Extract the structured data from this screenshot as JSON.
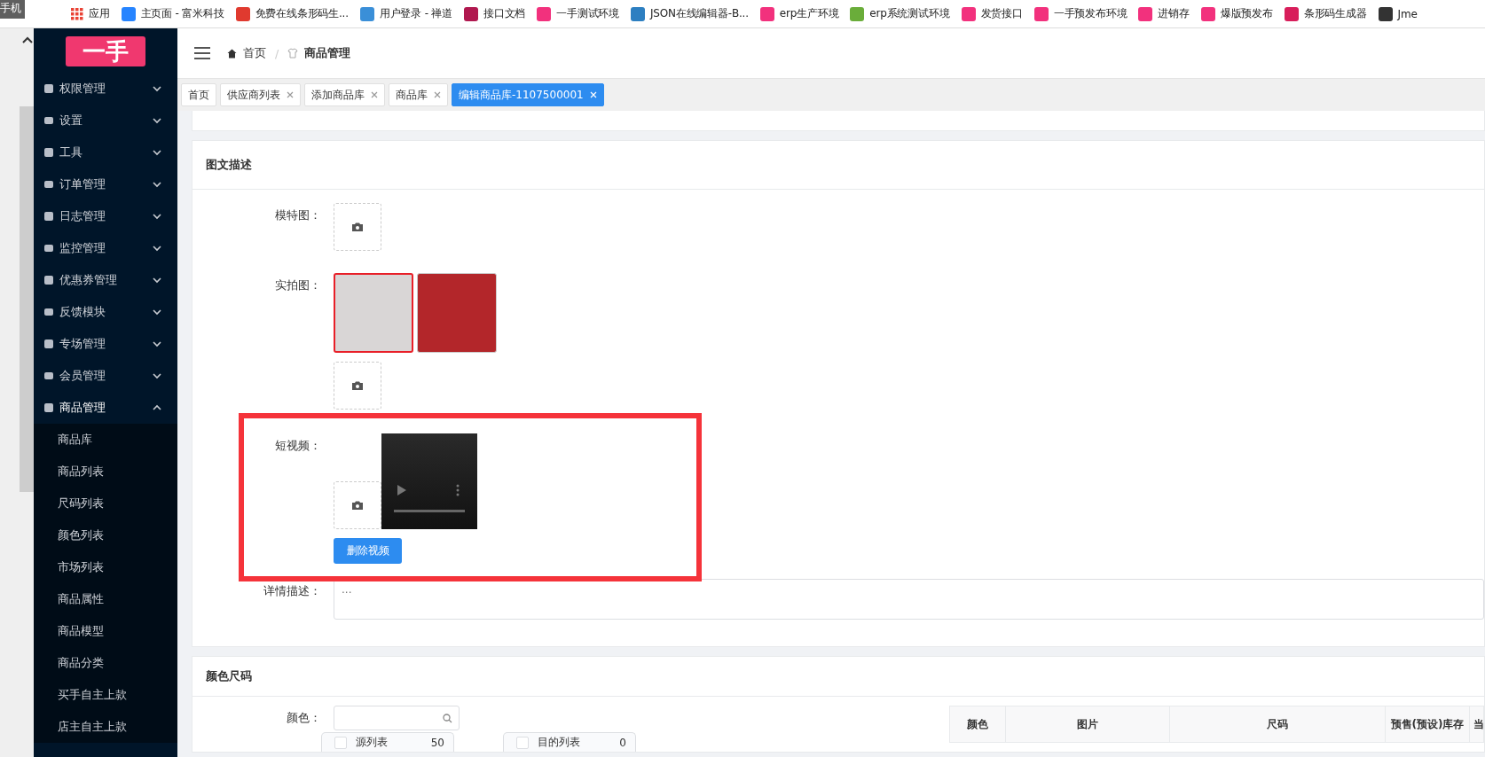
{
  "browser": {
    "tab_fragment": "手机",
    "bookmarks": [
      {
        "label": "应用",
        "color": "#e94235"
      },
      {
        "label": "主页面 - 富米科技",
        "color": "#2684ff"
      },
      {
        "label": "免费在线条形码生...",
        "color": "#e03a2f"
      },
      {
        "label": "用户登录 - 禅道",
        "color": "#3a8fd8"
      },
      {
        "label": "接口文档",
        "color": "#b0184f"
      },
      {
        "label": "一手测试环境",
        "color": "#f2317d"
      },
      {
        "label": "JSON在线编辑器-B...",
        "color": "#2d7fc1"
      },
      {
        "label": "erp生产环境",
        "color": "#f2317d"
      },
      {
        "label": "erp系统测试环境",
        "color": "#6aad3a"
      },
      {
        "label": "发货接口",
        "color": "#f2317d"
      },
      {
        "label": "一手预发布环境",
        "color": "#f2317d"
      },
      {
        "label": "进销存",
        "color": "#f2317d"
      },
      {
        "label": "爆版预发布",
        "color": "#f2317d"
      },
      {
        "label": "条形码生成器",
        "color": "#d81e5b"
      },
      {
        "label": "Jme",
        "color": "#333333"
      }
    ]
  },
  "sidebar": {
    "logo": "一手",
    "items": [
      {
        "label": "权限管理",
        "expanded": false
      },
      {
        "label": "设置",
        "expanded": false
      },
      {
        "label": "工具",
        "expanded": false
      },
      {
        "label": "订单管理",
        "expanded": false
      },
      {
        "label": "日志管理",
        "expanded": false
      },
      {
        "label": "监控管理",
        "expanded": false
      },
      {
        "label": "优惠券管理",
        "expanded": false
      },
      {
        "label": "反馈模块",
        "expanded": false
      },
      {
        "label": "专场管理",
        "expanded": false
      },
      {
        "label": "会员管理",
        "expanded": false
      },
      {
        "label": "商品管理",
        "expanded": true,
        "children": [
          {
            "label": "商品库"
          },
          {
            "label": "商品列表"
          },
          {
            "label": "尺码列表"
          },
          {
            "label": "颜色列表"
          },
          {
            "label": "市场列表"
          },
          {
            "label": "商品属性"
          },
          {
            "label": "商品模型"
          },
          {
            "label": "商品分类"
          },
          {
            "label": "买手自主上款"
          },
          {
            "label": "店主自主上款"
          }
        ]
      }
    ]
  },
  "header": {
    "breadcrumb": [
      "首页",
      "商品管理"
    ],
    "separator": "/"
  },
  "tabs": [
    {
      "label": "首页",
      "closable": false,
      "selected": false
    },
    {
      "label": "供应商列表",
      "closable": true,
      "selected": false
    },
    {
      "label": "添加商品库",
      "closable": true,
      "selected": false
    },
    {
      "label": "商品库",
      "closable": true,
      "selected": false
    },
    {
      "label": "编辑商品库-1107500001",
      "closable": true,
      "selected": true
    }
  ],
  "image_text_card": {
    "title": "图文描述",
    "model_image": {
      "label": "模特图："
    },
    "real_photos": {
      "label": "实拍图：",
      "photos": [
        {
          "selected": true
        },
        {
          "selected": false
        }
      ]
    },
    "short_video": {
      "label": "短视频：",
      "delete_button": "删除视频"
    },
    "detail": {
      "label": "详情描述：",
      "placeholder": "..."
    }
  },
  "color_size_card": {
    "title": "颜色尺码",
    "color_field": {
      "label": "颜色："
    },
    "source_list": {
      "title": "源列表",
      "count": "50",
      "checked": false
    },
    "target_list": {
      "title": "目的列表",
      "count": "0",
      "checked": false
    },
    "table": {
      "columns": [
        "颜色",
        "图片",
        "尺码",
        "预售(预设)库存",
        "当"
      ]
    }
  }
}
